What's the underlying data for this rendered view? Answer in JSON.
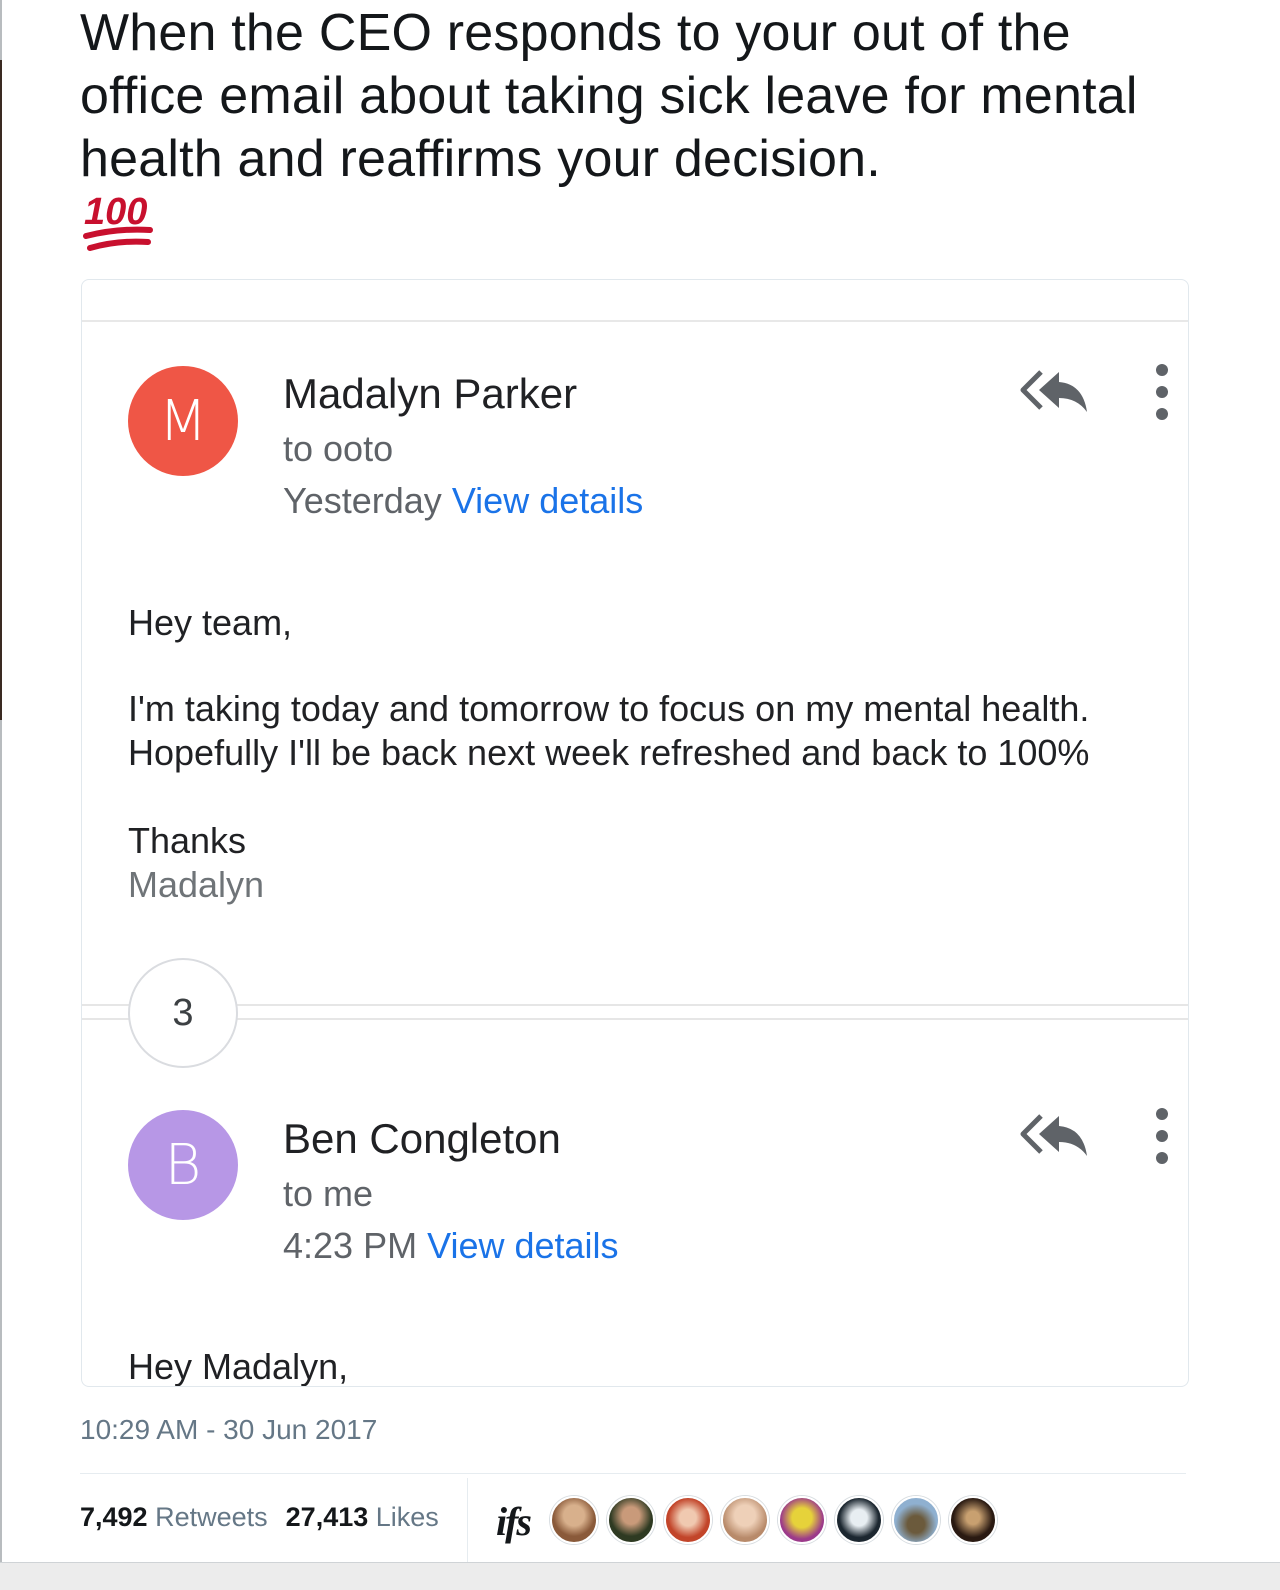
{
  "tweet": {
    "text": "When the CEO responds to your out of the office email about taking sick leave for mental health and reaffirms your decision.",
    "emoji_label": "100",
    "timestamp": "10:29 AM - 30 Jun 2017",
    "retweets_count": "7,492",
    "retweets_label": "Retweets",
    "likes_count": "27,413",
    "likes_label": "Likes",
    "likers_logo_text": "ifs"
  },
  "email_thread": {
    "message_1": {
      "avatar_letter": "M",
      "avatar_color": "#ef5646",
      "sender": "Madalyn Parker",
      "to": "to ooto",
      "time": "Yesterday",
      "view_details": "View details",
      "greeting": "Hey team,",
      "body_line_1": "I'm taking today and tomorrow to focus on my mental health.",
      "body_line_2": "Hopefully I'll be back next week refreshed and back to 100%",
      "thanks": "Thanks",
      "signature": "Madalyn"
    },
    "collapsed_count": "3",
    "message_2": {
      "avatar_letter": "B",
      "avatar_color": "#b797e6",
      "sender": "Ben Congleton",
      "to": "to me",
      "time": "4:23 PM",
      "view_details": "View details",
      "greeting": "Hey Madalyn,"
    }
  },
  "colors": {
    "link_blue": "#1a73e8",
    "emoji_red": "#c8102e"
  },
  "icons": [
    "reply-all-icon",
    "more-vertical-icon",
    "hundred-points-emoji"
  ]
}
